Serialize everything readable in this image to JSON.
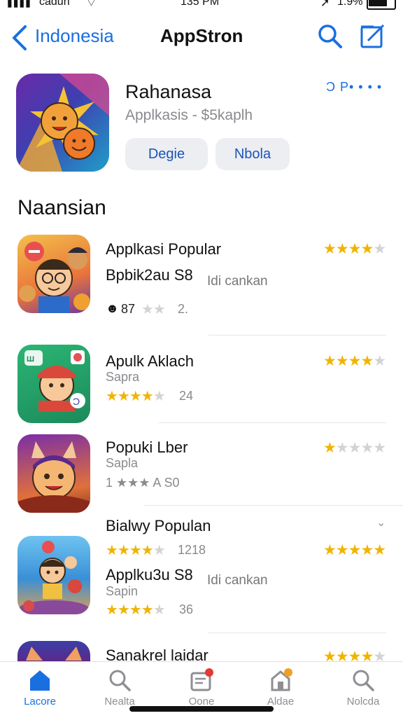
{
  "status": {
    "carrier": "cadun",
    "time": "135 PM",
    "battery": "1.9%"
  },
  "nav": {
    "back_label": "Indonesia",
    "title": "AppStron"
  },
  "hero": {
    "name": "Rahanasa",
    "subtitle": "Applkasis - $5kaplh",
    "button_1": "Degie",
    "button_2": "Nbola",
    "share": "Ɔ P• • • •"
  },
  "section_title": "Naansian",
  "rows": [
    {
      "title": "Applkasi Popular",
      "sub": "Bpbik2au S8",
      "note": "Idi cankan",
      "meta_num": "87",
      "meta_tail": "2.",
      "rating": 4
    },
    {
      "title": "Apulk Aklach",
      "sub": "Sapra",
      "meta": "24",
      "rating": 4
    },
    {
      "title": "Popuki Lber",
      "sub": "Sapla",
      "meta": "1 ★★★ A S0",
      "rating": 1
    },
    {
      "title": "Bialwy Populan",
      "sub": "Applku3u S8",
      "sub2": "Sapin",
      "note": "Idi cankan",
      "meta": "1218",
      "meta2": "36",
      "rating": 4
    },
    {
      "title": "Sanakrel laidar",
      "rating": 4
    }
  ],
  "tabs": [
    {
      "label": "Lacore"
    },
    {
      "label": "Nealta"
    },
    {
      "label": "Oone"
    },
    {
      "label": "Aldae"
    },
    {
      "label": "Nolcda"
    }
  ],
  "colors": {
    "accent": "#1a6fe0",
    "star": "#f0b400",
    "badge": "#e53935"
  }
}
